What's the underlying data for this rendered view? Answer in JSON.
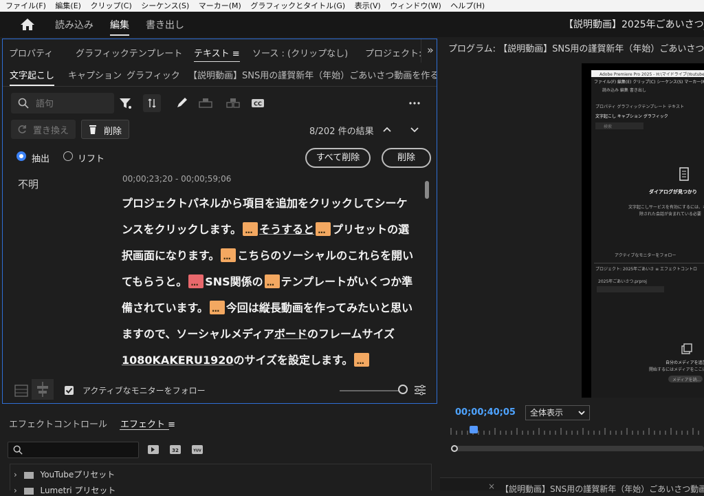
{
  "menu": [
    "ファイル(F)",
    "編集(E)",
    "クリップ(C)",
    "シーケンス(S)",
    "マーカー(M)",
    "グラフィックとタイトル(G)",
    "表示(V)",
    "ウィンドウ(W)",
    "ヘルプ(H)"
  ],
  "workspace": {
    "tabs": [
      "読み込み",
      "編集",
      "書き出し"
    ],
    "project_title": "【説明動画】2025年ごあいさつ_"
  },
  "panel": {
    "tabs": [
      "プロパティ",
      "グラフィックテンプレート",
      "テキスト ≡",
      "ソース : (クリップなし)",
      "プロジェクト:"
    ],
    "more": "»",
    "subtabs": [
      "文字起こし",
      "キャプション",
      "グラフィック"
    ],
    "sequence_name": "【説明動画】SNS用の謹賀新年（年始）ごあいさつ動画を作る",
    "search_placeholder": "語句",
    "replace_label": "置き換え",
    "delete_label": "削除",
    "results": "8/202 件の結果",
    "radio_extract": "抽出",
    "radio_lift": "リフト",
    "delete_all_label": "すべて削除",
    "delete_button_label": "削除",
    "speaker": "不明",
    "timecode_range": "00;00;23;20 - 00;00;59;06",
    "transcript": {
      "s1": "プロジェクトパネルから項目を追加をクリックしてシーケンスをクリックします。",
      "s2": "そうすると",
      "s3": "プリセットの選択画面になります。",
      "s4": "こちらのソーシャルのこれらを開いてもらうと。",
      "s5": "SNS関係の",
      "s6": "テンプレートがいくつか準備されています。",
      "s7": "今回は縦長動画を作ってみたいと思いますので、ソーシャルメディア",
      "s8": "ボード",
      "s9": "のフレームサイズ",
      "s10": "1080KAKERU1920",
      "s11": "のサイズを設定します。"
    },
    "follow_monitor": "アクティブなモニターをフォロー"
  },
  "effects_panel": {
    "tabs": [
      "エフェクトコントロール",
      "エフェクト ≡"
    ],
    "items": [
      "YouTubeプリセット",
      "Lumetri プリセット"
    ]
  },
  "program": {
    "title": "プログラム: 【説明動画】SNS用の謹賀新年（年始）ごあいさつ動画を",
    "timecode": "00;00;40;05",
    "zoom": "全体表示",
    "timeline_tab": "【説明動画】SNS用の謹賀新年（年始）ごあいさつ動画"
  },
  "thumbnail": {
    "app_title": "Adobe Premiere Pro 2025 - H:\\マイドライブ\\Youtube動画",
    "menu": "ファイル(F)  編集(E)  クリップ(C)  シーケンス(S)  マーカー(M)",
    "ws_tabs": "読み込み    編集    書き出し",
    "panel_tabs": "プロパティ   グラフィックテンプレート   テキスト",
    "subtabs": "文字起こし   キャプション   グラフィック",
    "search": "検索",
    "dialog_title": "ダイアログが見つかり",
    "dialog_text1": "文字起こしサービスを有効にするには、オ",
    "dialog_text2": "除された会話が含まれている必要",
    "follow": "アクティブなモニターをフォロー",
    "project_tab": "プロジェクト: 2025年ごあいさ ≡   エフェクトコントロ",
    "project_file": "2025年ごあいさつ.prproj",
    "media_title": "自分のメディアを追加",
    "media_text": "開始するにはメディアをここにドラッグするか、",
    "media_button": "メディアを読..."
  },
  "colors": {
    "accent": "#2f6fd6",
    "timecode": "#4ea3ff",
    "chip": "#f3a861",
    "chip_active": "#e8686c"
  }
}
